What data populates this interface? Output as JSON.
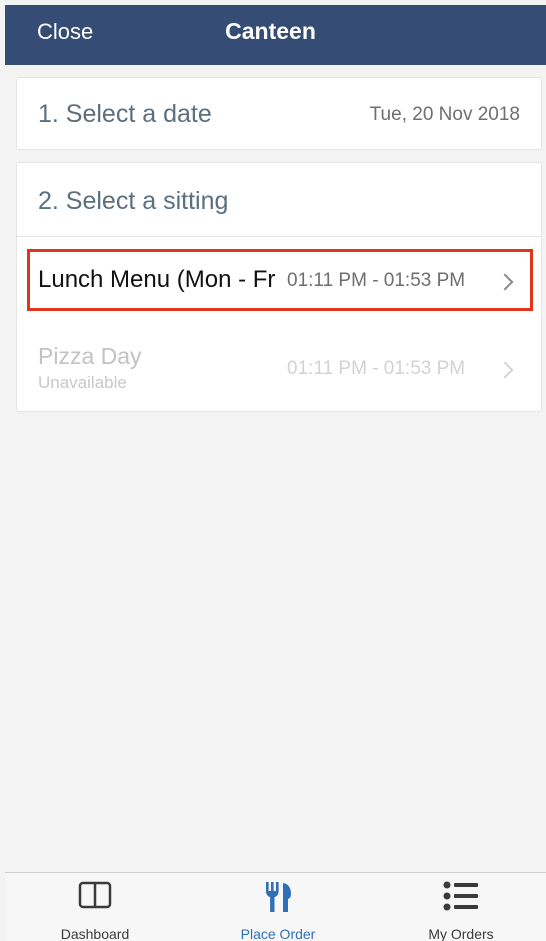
{
  "header": {
    "close_label": "Close",
    "title": "Canteen",
    "background_color": "#354d74"
  },
  "date_card": {
    "label": "1. Select a date",
    "value": "Tue, 20 Nov 2018"
  },
  "sitting_card": {
    "heading": "2. Select a sitting",
    "items": [
      {
        "name": "Lunch Menu (Mon - Fri)",
        "time": "01:11 PM - 01:53 PM",
        "available": true,
        "highlighted": true
      },
      {
        "name": "Pizza Day",
        "subtitle": "Unavailable",
        "time": "01:11 PM - 01:53 PM",
        "available": false
      }
    ],
    "highlight_color": "#e0361d"
  },
  "tabbar": {
    "tabs": [
      {
        "label": "Dashboard",
        "icon": "dashboard-icon"
      },
      {
        "label": "Place Order",
        "icon": "fork-knife-icon",
        "active": true
      },
      {
        "label": "My Orders",
        "icon": "list-icon"
      }
    ],
    "active_color": "#2f6fb8"
  }
}
